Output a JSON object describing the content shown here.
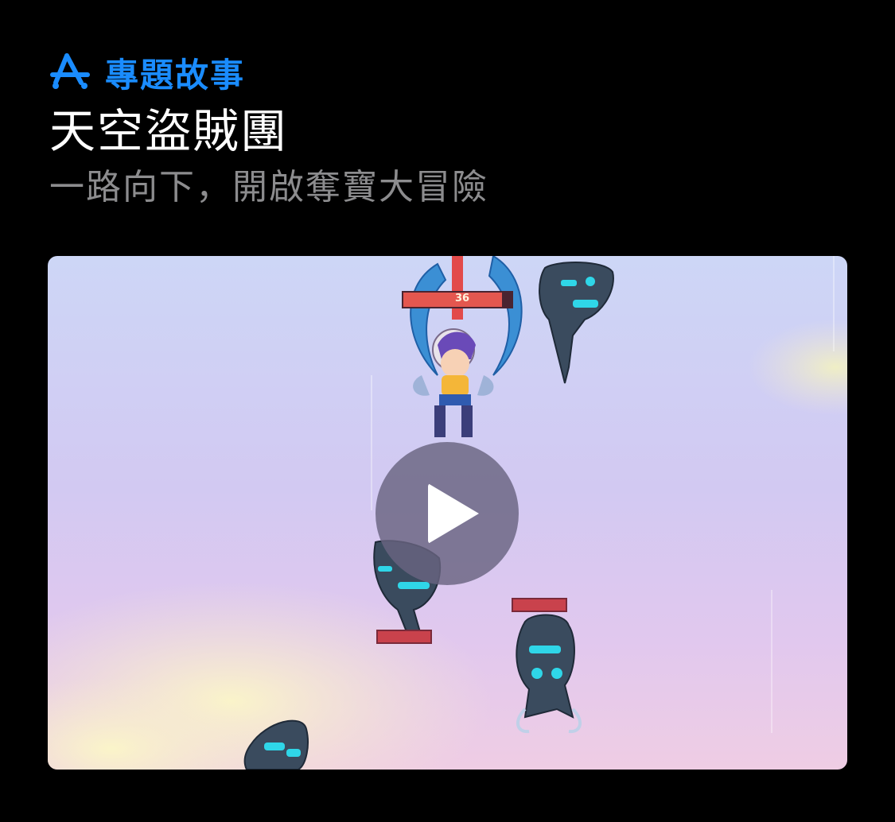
{
  "header": {
    "eyebrow_icon": "app-store-icon",
    "eyebrow_label": "專題故事",
    "eyebrow_color": "#1a8cff",
    "title": "天空盜賊團",
    "subtitle": "一路向下，開啟奪寶大冒險"
  },
  "media": {
    "type": "video",
    "play_icon": "play-icon",
    "player_hp": "36"
  }
}
